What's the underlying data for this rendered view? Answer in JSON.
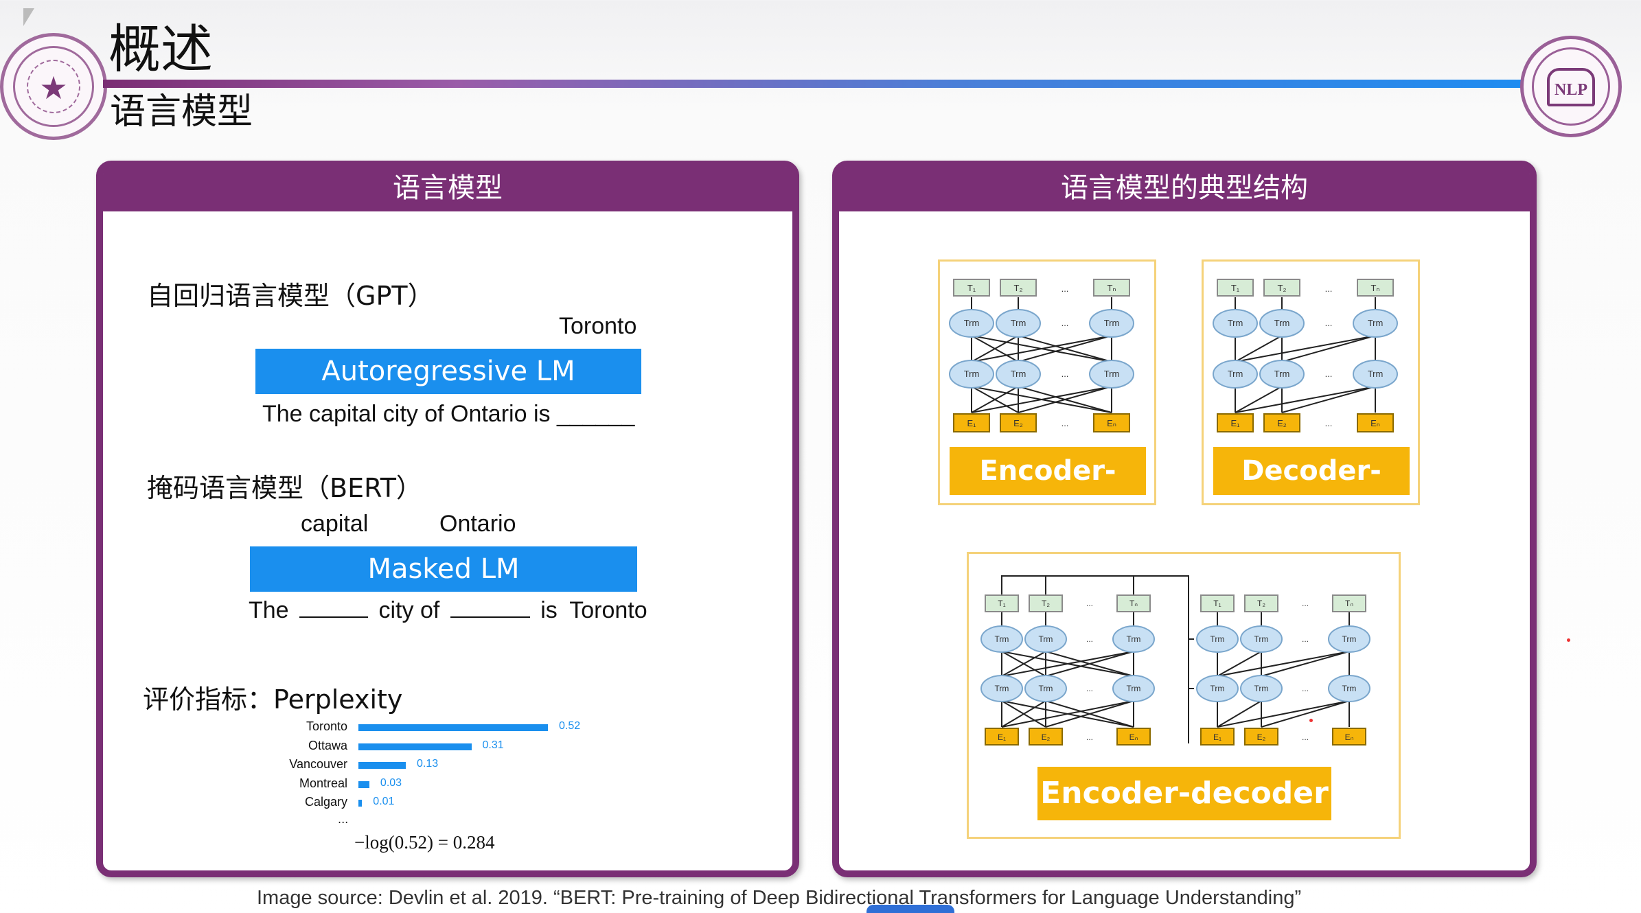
{
  "header": {
    "title": "概述",
    "subtitle": "语言模型",
    "accent_color": "#7a2f75"
  },
  "left_panel": {
    "heading": "语言模型",
    "gpt": {
      "label": "自回归语言模型（GPT）",
      "predicted_word": "Toronto",
      "bar_label": "Autoregressive LM",
      "sentence": "The capital city of Ontario is ______"
    },
    "bert": {
      "label": "掩码语言模型（BERT）",
      "predicted_word_1": "capital",
      "predicted_word_2": "Ontario",
      "bar_label": "Masked LM",
      "sentence_part_1": "The",
      "sentence_part_2": "city of",
      "sentence_part_3": "is",
      "sentence_part_4": "Toronto"
    },
    "metric": {
      "label": "评价指标：",
      "name": "Perplexity",
      "formula": "−log(0.52) = 0.284",
      "ellipsis": "..."
    }
  },
  "chart_data": {
    "type": "bar",
    "orientation": "horizontal",
    "categories": [
      "Toronto",
      "Ottawa",
      "Vancouver",
      "Montreal",
      "Calgary"
    ],
    "values": [
      0.52,
      0.31,
      0.13,
      0.03,
      0.01
    ],
    "value_labels": [
      "0.52",
      "0.31",
      "0.13",
      "0.03",
      "0.01"
    ],
    "color": "#1a8fee"
  },
  "right_panel": {
    "heading": "语言模型的典型结构",
    "encoder_only": "Encoder-only",
    "decoder_only": "Decoder-only",
    "encoder_decoder": "Encoder-decoder",
    "node_label": "Trm",
    "ellipsis": "...",
    "label_color": "#f6b50a"
  },
  "caption": "Image source: Devlin et al. 2019. “BERT: Pre-training of Deep Bidirectional Transformers for Language Understanding”"
}
